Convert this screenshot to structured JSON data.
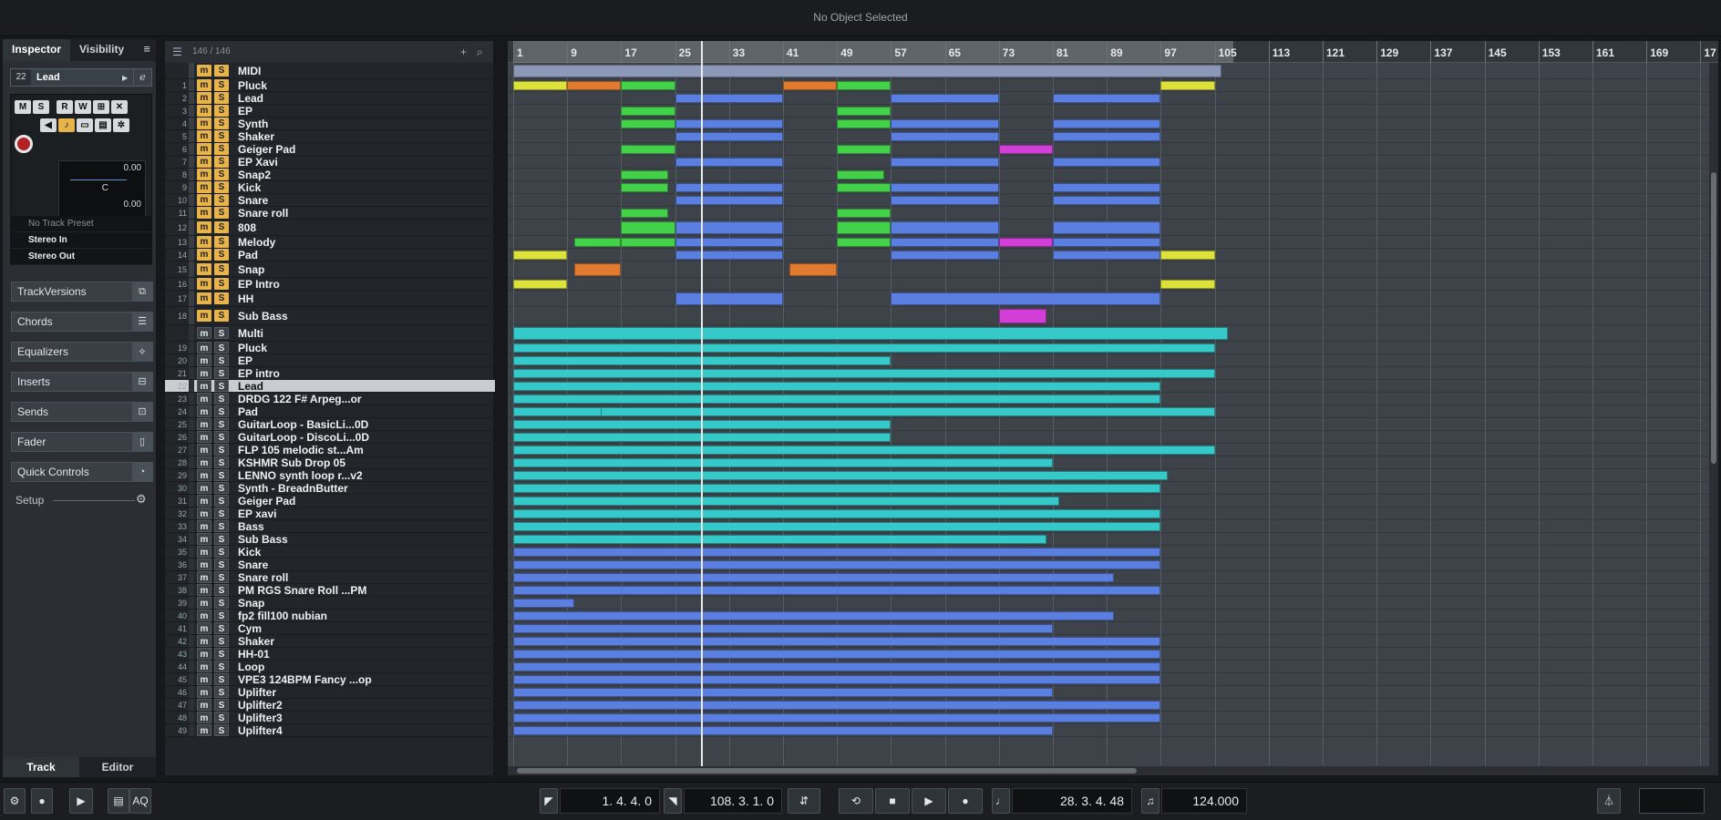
{
  "window": {
    "title": "No Object Selected"
  },
  "inspector": {
    "tabs": [
      "Inspector",
      "Visibility"
    ],
    "track_number": "22",
    "track_name": "Lead",
    "buttons_row1": [
      "M",
      "S",
      "R",
      "W",
      "⊞",
      "✕"
    ],
    "volume_value": "0.00",
    "pan_value": "C",
    "pan_value2": "0.00",
    "preset": "No Track Preset",
    "input": "Stereo In",
    "output": "Stereo Out",
    "sections": [
      "TrackVersions",
      "Chords",
      "Equalizers",
      "Inserts",
      "Sends",
      "Fader",
      "Quick Controls"
    ],
    "setup_label": "Setup",
    "bottom_tabs": [
      "Track",
      "Editor"
    ]
  },
  "tracklist": {
    "counter": "146 / 146",
    "tracks": [
      {
        "num": "",
        "name": "MIDI",
        "type": "folder"
      },
      {
        "num": "1",
        "name": "Pluck",
        "type": "midi"
      },
      {
        "num": "2",
        "name": "Lead",
        "type": "midi"
      },
      {
        "num": "3",
        "name": "EP",
        "type": "midi"
      },
      {
        "num": "4",
        "name": "Synth",
        "type": "midi"
      },
      {
        "num": "5",
        "name": "Shaker",
        "type": "midi"
      },
      {
        "num": "6",
        "name": "Geiger Pad",
        "type": "midi"
      },
      {
        "num": "7",
        "name": "EP Xavi",
        "type": "midi"
      },
      {
        "num": "8",
        "name": "Snap2",
        "type": "midi"
      },
      {
        "num": "9",
        "name": "Kick",
        "type": "midi"
      },
      {
        "num": "10",
        "name": "Snare",
        "type": "midi"
      },
      {
        "num": "11",
        "name": "Snare roll",
        "type": "midi"
      },
      {
        "num": "12",
        "name": "808",
        "type": "midi"
      },
      {
        "num": "13",
        "name": "Melody",
        "type": "midi"
      },
      {
        "num": "14",
        "name": "Pad",
        "type": "midi"
      },
      {
        "num": "15",
        "name": "Snap",
        "type": "midi"
      },
      {
        "num": "16",
        "name": "EP Intro",
        "type": "midi"
      },
      {
        "num": "17",
        "name": "HH",
        "type": "midi"
      },
      {
        "num": "18",
        "name": "Sub Bass",
        "type": "midi"
      },
      {
        "num": "",
        "name": "Multi",
        "type": "folder2"
      },
      {
        "num": "19",
        "name": "Pluck",
        "type": "audio"
      },
      {
        "num": "20",
        "name": "EP",
        "type": "audio"
      },
      {
        "num": "21",
        "name": "EP intro",
        "type": "audio"
      },
      {
        "num": "22",
        "name": "Lead",
        "type": "audio",
        "selected": true
      },
      {
        "num": "23",
        "name": "DRDG 122 F# Arpeg...or",
        "type": "audio"
      },
      {
        "num": "24",
        "name": "Pad",
        "type": "audio"
      },
      {
        "num": "25",
        "name": "GuitarLoop - BasicLi...0D",
        "type": "audio"
      },
      {
        "num": "26",
        "name": "GuitarLoop - DiscoLi...0D",
        "type": "audio"
      },
      {
        "num": "27",
        "name": "FLP 105 melodic st...Am",
        "type": "audio"
      },
      {
        "num": "28",
        "name": "KSHMR Sub Drop 05",
        "type": "audio"
      },
      {
        "num": "29",
        "name": "LENNO synth loop r...v2",
        "type": "audio"
      },
      {
        "num": "30",
        "name": "Synth - BreadnButter",
        "type": "audio"
      },
      {
        "num": "31",
        "name": "Geiger Pad",
        "type": "audio"
      },
      {
        "num": "32",
        "name": "EP xavi",
        "type": "audio"
      },
      {
        "num": "33",
        "name": "Bass",
        "type": "audio"
      },
      {
        "num": "34",
        "name": "Sub Bass",
        "type": "audio"
      },
      {
        "num": "35",
        "name": "Kick",
        "type": "audio"
      },
      {
        "num": "36",
        "name": "Snare",
        "type": "audio"
      },
      {
        "num": "37",
        "name": "Snare roll",
        "type": "audio"
      },
      {
        "num": "38",
        "name": "PM RGS Snare Roll ...PM",
        "type": "audio"
      },
      {
        "num": "39",
        "name": "Snap",
        "type": "audio"
      },
      {
        "num": "40",
        "name": "fp2 fill100 nubian",
        "type": "audio"
      },
      {
        "num": "41",
        "name": "Cym",
        "type": "audio"
      },
      {
        "num": "42",
        "name": "Shaker",
        "type": "audio"
      },
      {
        "num": "43",
        "name": "HH-01",
        "type": "audio"
      },
      {
        "num": "44",
        "name": "Loop",
        "type": "audio"
      },
      {
        "num": "45",
        "name": "VPE3 124BPM Fancy ...op",
        "type": "audio"
      },
      {
        "num": "46",
        "name": "Uplifter",
        "type": "audio"
      },
      {
        "num": "47",
        "name": "Uplifter2",
        "type": "audio"
      },
      {
        "num": "48",
        "name": "Uplifter3",
        "type": "audio"
      },
      {
        "num": "49",
        "name": "Uplifter4",
        "type": "audio"
      }
    ]
  },
  "ruler": {
    "bars": [
      "1",
      "9",
      "17",
      "25",
      "33",
      "41",
      "49",
      "57",
      "65",
      "73",
      "81",
      "89",
      "97",
      "105",
      "113",
      "121",
      "129",
      "137",
      "145",
      "153",
      "161",
      "169",
      "17"
    ]
  },
  "transport": {
    "left_locator": "1. 4. 4. 0",
    "right_locator": "108. 3. 1. 0",
    "position": "28. 3. 4. 48",
    "tempo": "124.000",
    "aq_label": "AQ"
  },
  "colors": {
    "green": "#43d14a",
    "blue": "#5b7fe0",
    "orange": "#e07a2e",
    "yellow": "#dde23a",
    "magenta": "#d13fd8",
    "cyan": "#35c9c9",
    "gray": "#8b98b8"
  }
}
